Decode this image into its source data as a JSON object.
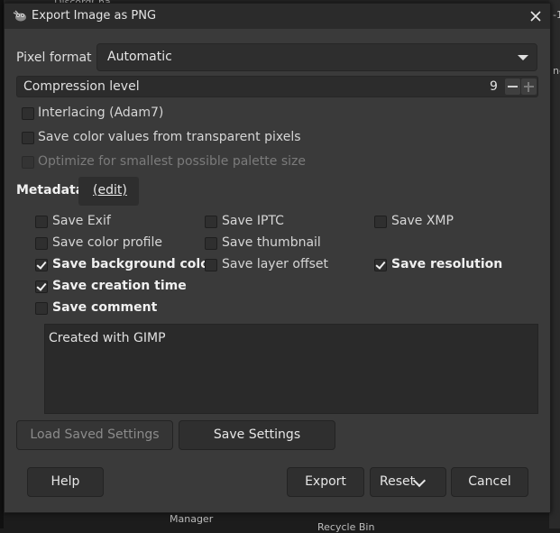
{
  "background": {
    "top_text": "DiscordCha...",
    "right_texts": [
      "-1",
      "ne"
    ],
    "bottom_text": "Manager",
    "bottom_text2": "Recycle Bin"
  },
  "dialog": {
    "title": "Export Image as PNG",
    "pixel_format": {
      "label": "Pixel format",
      "value": "Automatic"
    },
    "compression": {
      "label": "Compression level",
      "value": "9"
    },
    "options": [
      {
        "label": "Interlacing (Adam7)",
        "checked": false,
        "enabled": true
      },
      {
        "label": "Save color values from transparent pixels",
        "checked": false,
        "enabled": true
      },
      {
        "label": "Optimize for smallest possible palette size",
        "checked": false,
        "enabled": false
      }
    ],
    "metadata": {
      "label": "Metadata",
      "edit_label": "(edit)",
      "items": [
        {
          "label": "Save Exif",
          "checked": false
        },
        {
          "label": "Save IPTC",
          "checked": false
        },
        {
          "label": "Save XMP",
          "checked": false
        },
        {
          "label": "Save color profile",
          "checked": false
        },
        {
          "label": "Save thumbnail",
          "checked": false
        },
        {
          "label": "Save background color",
          "checked": true
        },
        {
          "label": "Save layer offset",
          "checked": false
        },
        {
          "label": "Save resolution",
          "checked": true
        },
        {
          "label": "Save creation time",
          "checked": true
        },
        {
          "label": "Save comment",
          "checked": false
        }
      ],
      "comment": "Created with GIMP"
    },
    "buttons": {
      "load_settings": "Load Saved Settings",
      "save_settings": "Save Settings",
      "help": "Help",
      "export": "Export",
      "reset": "Reset",
      "cancel": "Cancel"
    }
  },
  "colors": {
    "dialog_bg": "#3a3a3a",
    "titlebar_bg": "#2b2b2b",
    "field_bg": "#2e2e2e"
  }
}
